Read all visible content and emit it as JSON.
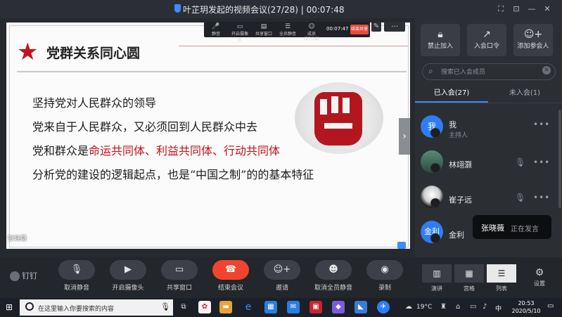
{
  "window": {
    "title": "叶芷玥发起的视频会议(27/28) | 00:07:48"
  },
  "slide": {
    "heading": "党群关系同心圆",
    "lines": [
      {
        "plain": "坚持党对人民群众的领导"
      },
      {
        "plain": "党来自于人民群众，又必须回到人民群众中去"
      },
      {
        "plain": "党和群众是",
        "red": "命运共同体、利益共同体、行动共同体"
      },
      {
        "plain": "分析党的建设的逻辑起点，也是“中国之制”的的基本特征"
      }
    ],
    "caption": "张晓薇"
  },
  "mini_toolbar": {
    "items": [
      "静音",
      "开启摄像头",
      "共享窗口",
      "全员静音",
      "成员(27/28)"
    ],
    "time": "00:07:47",
    "end_label": "结束共享"
  },
  "panel": {
    "buttons": [
      {
        "label": "禁止加入",
        "icon": "lock-icon"
      },
      {
        "label": "入会口令",
        "icon": "share-icon"
      },
      {
        "label": "添加参会人",
        "icon": "add-person-icon"
      }
    ],
    "search_placeholder": "搜索已入会成员",
    "tabs": {
      "joined": "已入会(27)",
      "not_joined": "未入会(1)"
    },
    "members": [
      {
        "name": "我",
        "role": "主持人",
        "avatar_text": "我"
      },
      {
        "name": "林翊灏",
        "role": ""
      },
      {
        "name": "崔子远",
        "role": ""
      },
      {
        "name": "金利",
        "role": "",
        "avatar_text": "金利"
      }
    ],
    "speaker": {
      "name": "张晓薇",
      "status": "正在发言"
    }
  },
  "controls": {
    "logo": "钉钉",
    "buttons": [
      {
        "label": "取消静音",
        "icon": "mic-off-icon"
      },
      {
        "label": "开启摄像头",
        "icon": "camera-icon"
      },
      {
        "label": "共享窗口",
        "icon": "share-screen-icon"
      },
      {
        "label": "结束会议",
        "icon": "hangup-icon"
      },
      {
        "label": "邀请",
        "icon": "invite-icon"
      },
      {
        "label": "取消全员静音",
        "icon": "mute-all-icon"
      },
      {
        "label": "录制",
        "icon": "record-icon"
      }
    ],
    "views": [
      {
        "label": "演讲"
      },
      {
        "label": "宫格"
      },
      {
        "label": "列表"
      }
    ],
    "settings": "设置"
  },
  "taskbar": {
    "search_placeholder": "在这里输入你要搜索的内容",
    "temperature": "19°C",
    "ime": "中",
    "time": "20:53",
    "date": "2020/5/10"
  },
  "colors": {
    "accent": "#3d8bfd",
    "end_red": "#f0442f",
    "slide_red": "#c4121a"
  }
}
